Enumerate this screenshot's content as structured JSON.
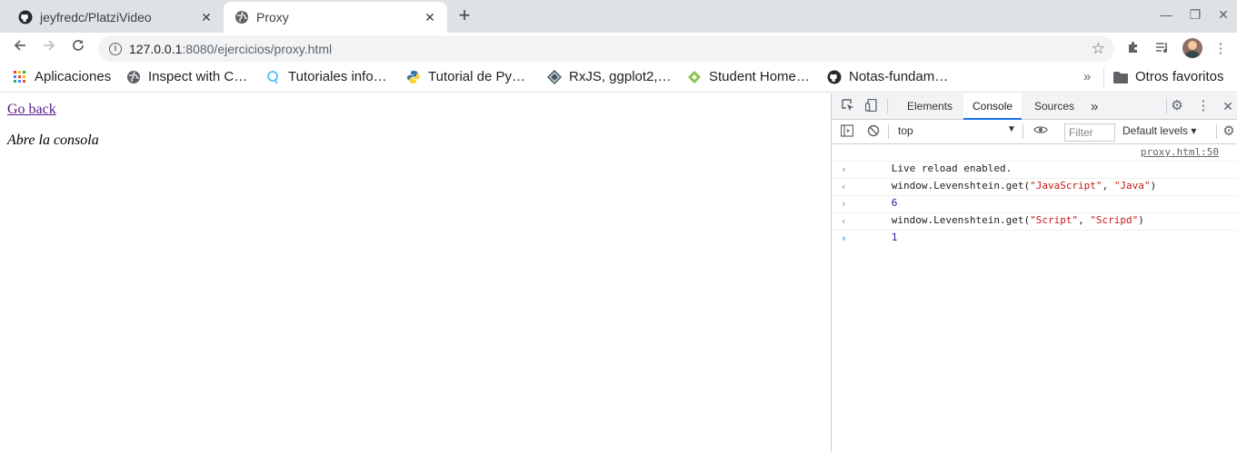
{
  "tabs": [
    {
      "title": "jeyfredc/PlatziVideo",
      "icon": "github-icon",
      "close": "✕"
    },
    {
      "title": "Proxy",
      "icon": "globe-icon",
      "close": "✕"
    }
  ],
  "new_tab": "+",
  "window_controls": {
    "minimize": "—",
    "maximize": "❐",
    "close": "✕"
  },
  "address_bar": {
    "host": "127.0.0.1",
    "rest": ":8080/ejercicios/proxy.html"
  },
  "bookmarks": [
    {
      "label": "Aplicaciones",
      "icon": "apps-grid-icon"
    },
    {
      "label": "Inspect with C…",
      "icon": "globe-icon"
    },
    {
      "label": "Tutoriales info…",
      "icon": "search-bubble-icon"
    },
    {
      "label": "Tutorial de Py…",
      "icon": "python-icon"
    },
    {
      "label": "RxJS, ggplot2,…",
      "icon": "diamond-icon"
    },
    {
      "label": "Student Home…",
      "icon": "green-diamond-icon"
    },
    {
      "label": "Notas-fundam…",
      "icon": "github-icon"
    }
  ],
  "bookmarks_overflow": "»",
  "other_bookmarks": "Otros favoritos",
  "page": {
    "link": "Go back",
    "hint": "Abre la consola"
  },
  "devtools": {
    "tabs": [
      "Elements",
      "Console",
      "Sources"
    ],
    "active_tab": "Console",
    "more_tabs": "»",
    "context": "top",
    "filter_placeholder": "Filter",
    "levels": "Default levels ▾",
    "console": {
      "log_text": "Live reload enabled.",
      "log_source": "proxy.html:50",
      "cmd1_fn": "window.Levenshtein.get(",
      "cmd1_a": "\"JavaScript\"",
      "sep": ", ",
      "cmd1_b": "\"Java\"",
      "close": ")",
      "res1": "6",
      "cmd2_fn": "window.Levenshtein.get(",
      "cmd2_a": "\"Script\"",
      "cmd2_b": "\"Scripd\"",
      "res2": "1"
    }
  },
  "colors": {
    "accent": "#1a73e8",
    "link": "#551a8b",
    "string": "#c41a16",
    "number": "#1a1aa6"
  }
}
